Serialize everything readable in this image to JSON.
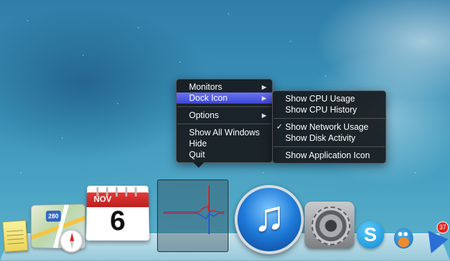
{
  "main_menu": {
    "items": [
      {
        "label": "Monitors",
        "submenu": true
      },
      {
        "label": "Dock Icon",
        "submenu": true,
        "selected": true
      },
      {
        "label": "Options",
        "submenu": true
      },
      {
        "label": "Show All Windows"
      },
      {
        "label": "Hide"
      },
      {
        "label": "Quit"
      }
    ]
  },
  "dock_icon_submenu": {
    "items": [
      {
        "label": "Show CPU Usage"
      },
      {
        "label": "Show CPU History"
      },
      {
        "label": "Show Network Usage",
        "checked": true
      },
      {
        "label": "Show Disk Activity"
      },
      {
        "label": "Show Application Icon"
      }
    ]
  },
  "dock": {
    "calendar": {
      "month": "NOV",
      "day": "6"
    },
    "maps_shield": "280",
    "skype_letter": "S",
    "notification_badge": "37",
    "apps": [
      "stickies-icon",
      "maps-icon",
      "calendar-icon",
      "activity-monitor-icon",
      "itunes-icon",
      "system-preferences-icon",
      "skype-icon",
      "bird-app-icon",
      "send-to-icon"
    ]
  },
  "colors": {
    "menu_highlight": "#4f58e2",
    "graph_red": "#d22222",
    "graph_blue": "#2f56c8"
  }
}
